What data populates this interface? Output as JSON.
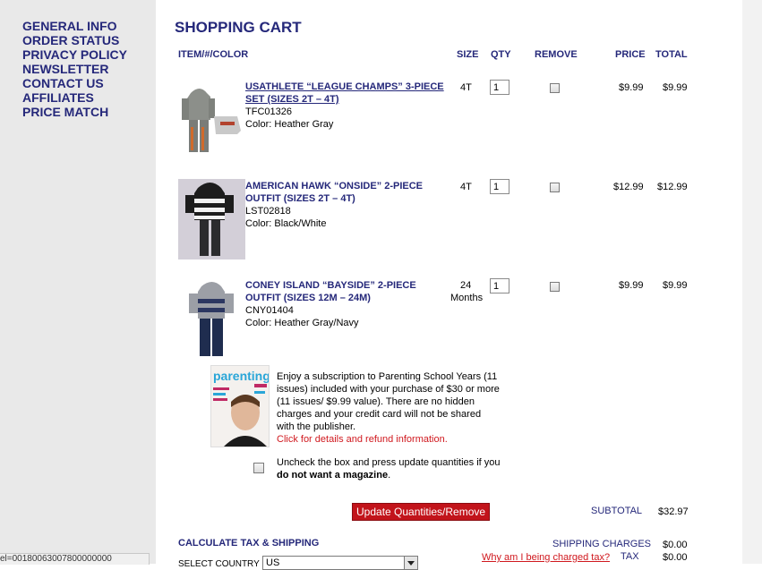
{
  "sidebar": {
    "items": [
      {
        "label": "GENERAL INFO"
      },
      {
        "label": "ORDER STATUS"
      },
      {
        "label": "PRIVACY POLICY"
      },
      {
        "label": "NEWSLETTER"
      },
      {
        "label": "CONTACT US"
      },
      {
        "label": "AFFILIATES"
      },
      {
        "label": "PRICE MATCH"
      }
    ]
  },
  "cart": {
    "title": "SHOPPING CART",
    "headers": {
      "item": "ITEM/#/COLOR",
      "size": "SIZE",
      "qty": "QTY",
      "remove": "REMOVE",
      "price": "PRICE",
      "total": "TOTAL"
    },
    "items": [
      {
        "name": "USATHLETE “LEAGUE CHAMPS” 3-PIECE SET (SIZES 2T – 4T)",
        "sku": "TFC01326",
        "color": "Color: Heather Gray",
        "size": "4T",
        "qty": "1",
        "price": "$9.99",
        "total": "$9.99"
      },
      {
        "name": "AMERICAN HAWK “ONSIDE” 2-PIECE OUTFIT (SIZES 2T – 4T)",
        "sku": "LST02818",
        "color": "Color: Black/White",
        "size": "4T",
        "qty": "1",
        "price": "$12.99",
        "total": "$12.99"
      },
      {
        "name": "CONEY ISLAND “BAYSIDE” 2-PIECE OUTFIT (SIZES 12M – 24M)",
        "sku": "CNY01404",
        "color": "Color: Heather Gray/Navy",
        "size_line1": "24",
        "size_line2": "Months",
        "qty": "1",
        "price": "$9.99",
        "total": "$9.99"
      }
    ],
    "promo": {
      "text": "Enjoy a subscription to Parenting School Years (11 issues) included with your purchase of $30 or more (11 issues/ $9.99 value). There are no hidden charges and your credit card will not be shared with the publisher.",
      "details_link": "Click for details and refund information.",
      "uncheck_text_a": "Uncheck the box and press update quantities if you ",
      "uncheck_text_b": "do not want a magazine",
      "uncheck_text_c": ".",
      "magazine_title": "parenting"
    },
    "update_button": "Update Quantities/Remove",
    "subtotal_label": "SUBTOTAL",
    "subtotal_value": "$32.97",
    "shipping_section_title": "CALCULATE TAX & SHIPPING",
    "shipping_label": "SHIPPING CHARGES",
    "shipping_value": "$0.00",
    "tax_link": "Why am I being charged tax?",
    "tax_label": "TAX",
    "tax_value": "$0.00",
    "country_label": "SELECT COUNTRY",
    "country_value": "US"
  },
  "status_bar": {
    "text": "el=00180063007800000000"
  },
  "colors": {
    "navy": "#25287a",
    "red": "#c2141b",
    "sidebar_bg": "#e9e9e9"
  }
}
